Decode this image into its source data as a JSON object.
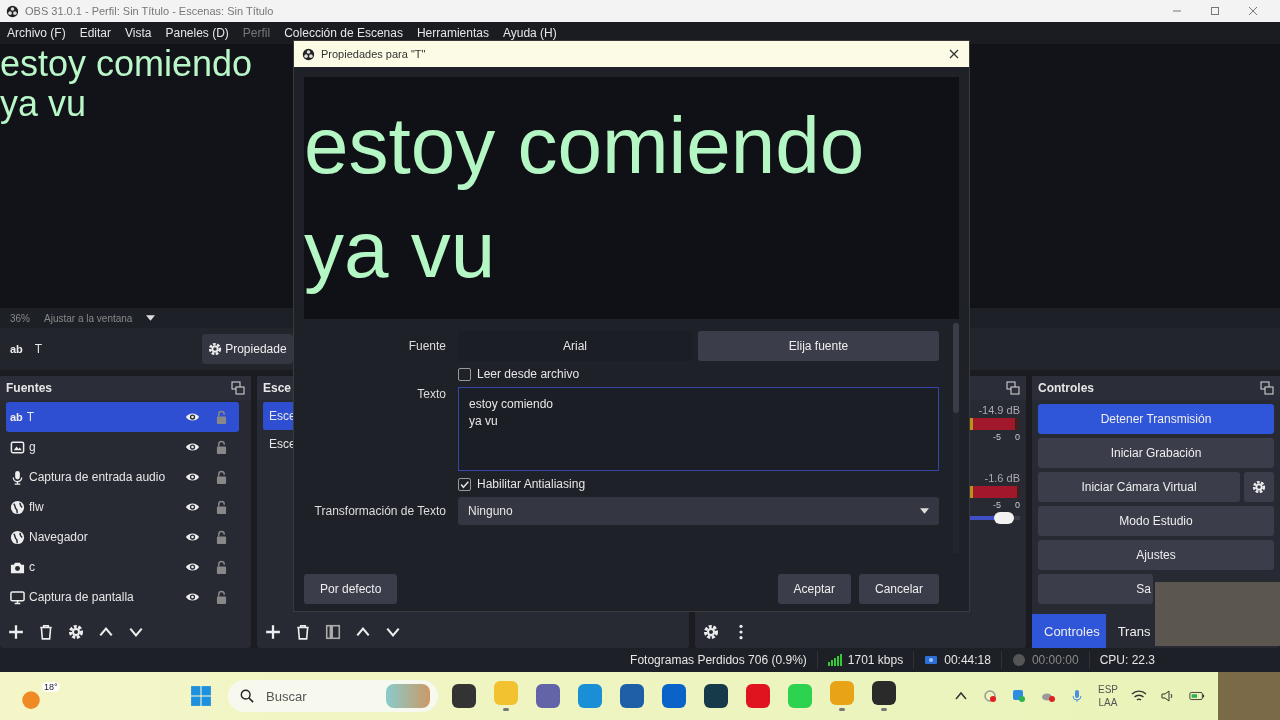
{
  "window": {
    "title": "OBS 31.0.1 - Perfil: Sin Título - Escenas: Sin Título"
  },
  "menu": [
    {
      "label": "Archivo (F)",
      "disabled": false
    },
    {
      "label": "Editar",
      "disabled": false
    },
    {
      "label": "Vista",
      "disabled": false
    },
    {
      "label": "Paneles (D)",
      "disabled": false
    },
    {
      "label": "Perfil",
      "disabled": true
    },
    {
      "label": "Colección de Escenas",
      "disabled": false
    },
    {
      "label": "Herramientas",
      "disabled": false
    },
    {
      "label": "Ayuda (H)",
      "disabled": false
    }
  ],
  "preview": {
    "lines": [
      "estoy comiendo",
      "ya vu"
    ],
    "zoom": "36%",
    "fit": "Ajustar a la ventana"
  },
  "source_toolbar": {
    "icon": "ab",
    "source": "T",
    "button": "Propiedade"
  },
  "sources": {
    "title": "Fuentes",
    "items": [
      {
        "kind": "text",
        "icon": "ab",
        "name": "T",
        "selected": true
      },
      {
        "kind": "image",
        "name": "g",
        "selected": false
      },
      {
        "kind": "audio",
        "name": "Captura de entrada audio",
        "selected": false
      },
      {
        "kind": "browser",
        "name": "flw",
        "selected": false
      },
      {
        "kind": "browser",
        "name": "Navegador",
        "selected": false
      },
      {
        "kind": "camera",
        "name": "c",
        "selected": false
      },
      {
        "kind": "display",
        "name": "Captura de pantalla",
        "selected": false
      }
    ]
  },
  "scenes": {
    "title": "Esce",
    "items": [
      {
        "name": "Esce",
        "selected": true
      },
      {
        "name": "Esce",
        "selected": false
      }
    ]
  },
  "mixer": {
    "channels": [
      {
        "reading": "-14.9 dB",
        "ticks": [
          "-5",
          "0"
        ],
        "meter": {
          "level": 0.9
        }
      },
      {
        "reading": "-1.6 dB",
        "ticks": [
          "-5",
          "0"
        ],
        "meter": {
          "level": 0.95
        },
        "fader": {
          "level": 0.7
        }
      }
    ]
  },
  "controls": {
    "title": "Controles",
    "buttons": [
      {
        "kind": "plain",
        "label": "Detener Transmisión",
        "active": true
      },
      {
        "kind": "plain",
        "label": "Iniciar Grabación",
        "active": false
      },
      {
        "kind": "with-settings",
        "label": "Iniciar Cámara Virtual",
        "active": false
      },
      {
        "kind": "plain",
        "label": "Modo Estudio",
        "active": false
      },
      {
        "kind": "plain",
        "label": "Ajustes",
        "active": false
      },
      {
        "kind": "plain",
        "label": "Sa",
        "active": false
      }
    ],
    "tabs": [
      {
        "label": "Controles",
        "selected": true
      },
      {
        "label": "Trans",
        "selected": false
      }
    ]
  },
  "status_bar": {
    "dropped": "Fotogramas Perdidos 706 (0.9%)",
    "bitrate": "1701 kbps",
    "stream_time": "00:44:18",
    "record_time": "00:00:00",
    "cpu": "CPU: 22.3"
  },
  "dialog": {
    "title": "Propiedades para \"T\"",
    "preview_lines": [
      "estoy comiendo",
      "ya vu"
    ],
    "font_label": "Fuente",
    "font_value": "Arial",
    "font_button": "Elija fuente",
    "read_file": {
      "label": "Leer desde archivo",
      "checked": false
    },
    "text_label": "Texto",
    "text_value": "estoy comiendo\nya vu",
    "antialias": {
      "label": "Habilitar Antialiasing",
      "checked": true
    },
    "transform_label": "Transformación de Texto",
    "transform_value": "Ninguno",
    "defaults_button": "Por defecto",
    "ok_button": "Aceptar",
    "cancel_button": "Cancelar"
  },
  "taskbar": {
    "weather": "18°",
    "search": "Buscar",
    "language": [
      "ESP",
      "LAA"
    ],
    "apps": [
      {
        "kind": "taskview",
        "running": false
      },
      {
        "kind": "files",
        "running": true
      },
      {
        "kind": "teams",
        "running": false
      },
      {
        "kind": "edge",
        "running": false
      },
      {
        "kind": "store",
        "running": false
      },
      {
        "kind": "outlook",
        "running": false
      },
      {
        "kind": "disney",
        "running": false
      },
      {
        "kind": "opera",
        "running": false
      },
      {
        "kind": "whatsapp",
        "running": false
      },
      {
        "kind": "chrome",
        "running": true
      },
      {
        "kind": "obs",
        "running": true
      }
    ]
  }
}
